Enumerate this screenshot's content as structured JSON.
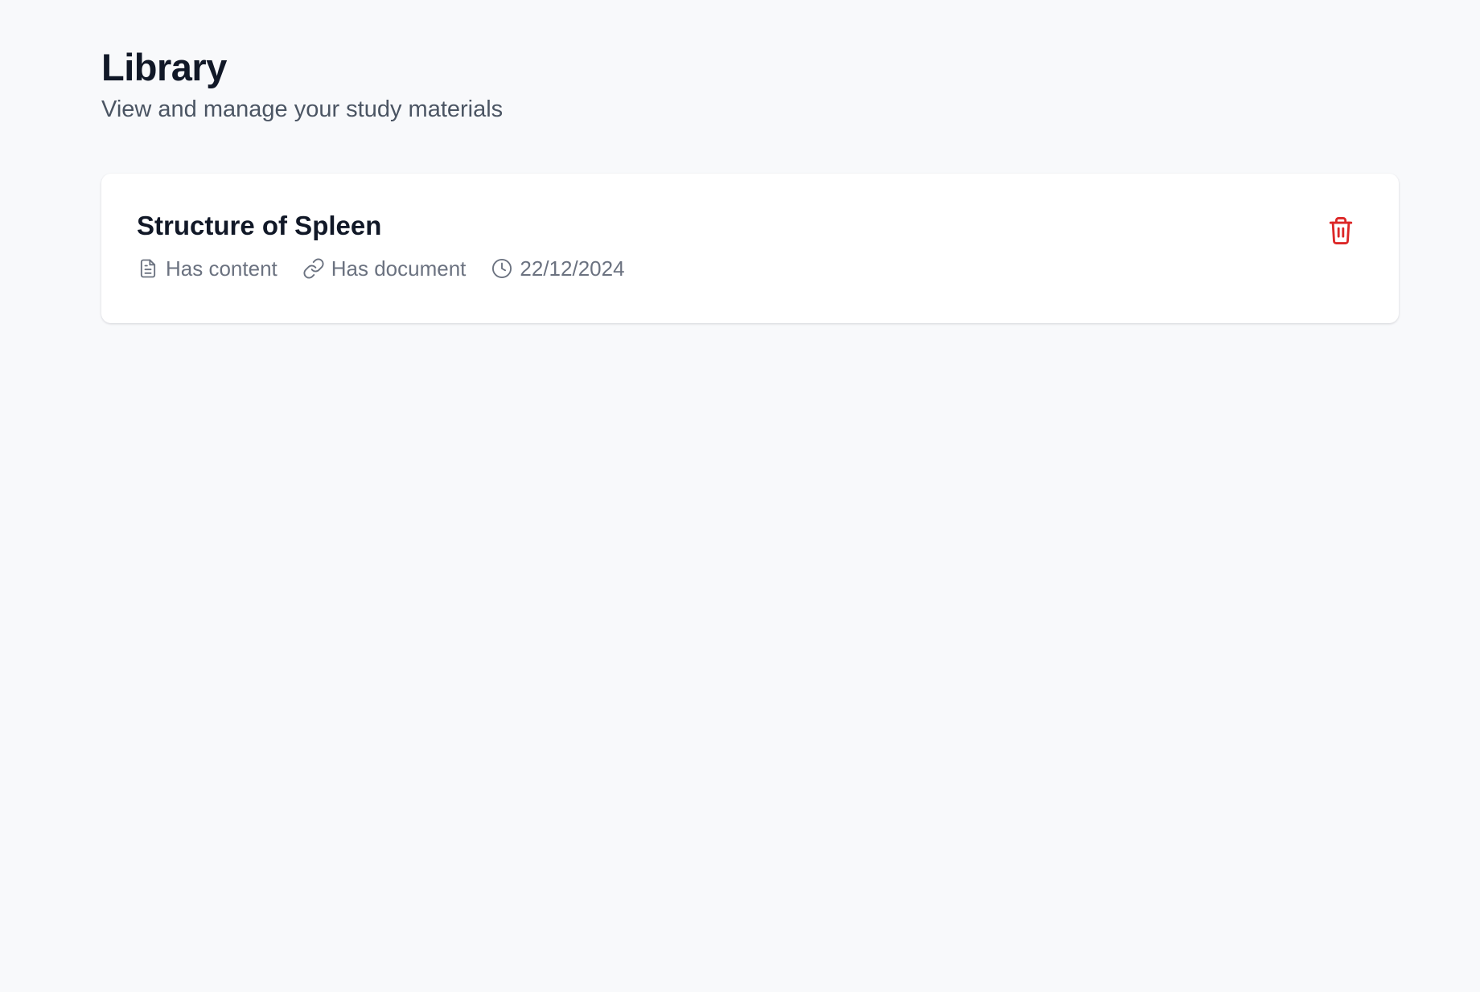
{
  "header": {
    "title": "Library",
    "subtitle": "View and manage your study materials"
  },
  "items": [
    {
      "title": "Structure of Spleen",
      "meta": {
        "content_label": "Has content",
        "document_label": "Has document",
        "date": "22/12/2024"
      },
      "icons": {
        "content": "document-icon",
        "document": "link-icon",
        "date": "clock-icon",
        "delete": "trash-icon"
      }
    }
  ],
  "colors": {
    "background": "#f8f9fb",
    "card": "#ffffff",
    "title": "#111827",
    "muted": "#6b7280",
    "danger": "#dc2626"
  }
}
